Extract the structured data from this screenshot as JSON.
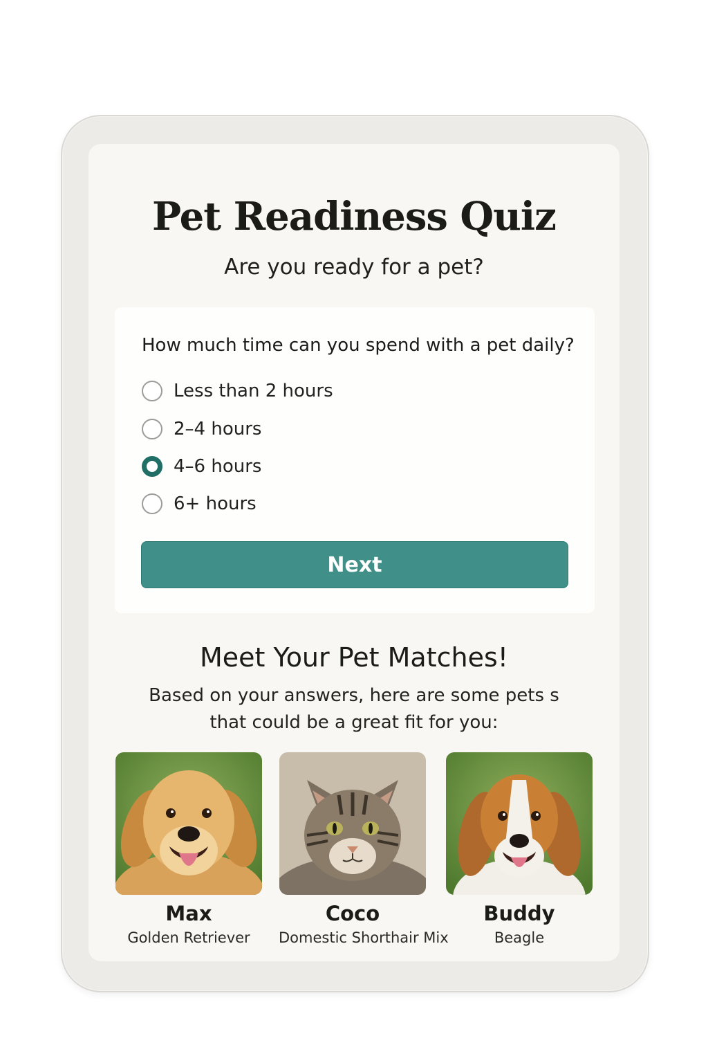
{
  "quiz": {
    "title": "Pet Readiness Quiz",
    "subtitle": "Are you ready for a pet?",
    "question": "How much time can you spend with a pet daily?",
    "options": [
      {
        "label": "Less than 2 hours",
        "selected": false
      },
      {
        "label": "2–4 hours",
        "selected": false
      },
      {
        "label": "4–6 hours",
        "selected": true
      },
      {
        "label": "6+ hours",
        "selected": false
      }
    ],
    "next_label": "Next"
  },
  "matches": {
    "title": "Meet Your Pet Matches!",
    "description": "Based on your answers, here are some pets s that could be a great fit for you:",
    "pets": [
      {
        "name": "Max",
        "breed": "Golden Retriever",
        "photo": "golden-retriever-photo"
      },
      {
        "name": "Coco",
        "breed": "Domestic Shorthair Mix",
        "photo": "tabby-cat-photo"
      },
      {
        "name": "Buddy",
        "breed": "Beagle",
        "photo": "beagle-photo"
      }
    ]
  },
  "colors": {
    "accent": "#418f89",
    "radio_selected": "#1f6f66",
    "screen_background": "#f8f7f3",
    "device_frame": "#ecebe8"
  }
}
